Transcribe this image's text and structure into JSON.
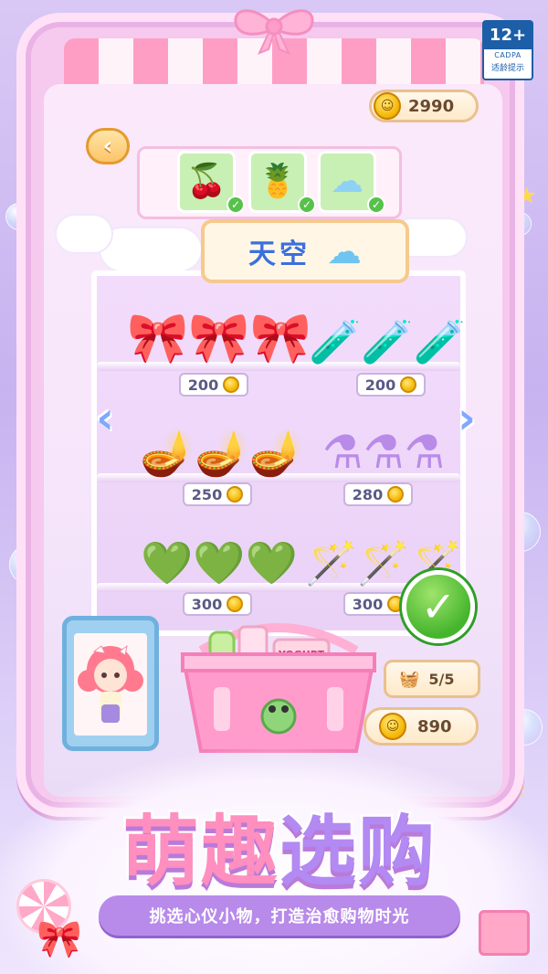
{
  "age_rating": {
    "number": "12+",
    "org": "CADPA",
    "label": "适龄提示"
  },
  "wallet": {
    "coins": "2990"
  },
  "nav": {
    "back_arrow": "‹"
  },
  "order": {
    "items": [
      {
        "icon": "cherry-icon",
        "glyph": "🍒",
        "done": "✓"
      },
      {
        "icon": "pineapple-icon",
        "glyph": "🍍",
        "done": "✓"
      },
      {
        "icon": "cloud-icon",
        "glyph": "☁",
        "done": "✓"
      }
    ]
  },
  "shelf": {
    "category": "天空",
    "prev_arrow": "‹",
    "next_arrow": "›",
    "rows": [
      {
        "items": [
          {
            "name": "bow-perfume-bottles",
            "glyph": "🎀",
            "price": "200"
          },
          {
            "name": "crown-potion-bottles",
            "glyph": "🧪",
            "price": "200"
          }
        ]
      },
      {
        "items": [
          {
            "name": "golden-lamps",
            "glyph": "🪔",
            "price": "250"
          },
          {
            "name": "heart-potion-flasks",
            "glyph": "⚗",
            "price": "280"
          }
        ]
      },
      {
        "items": [
          {
            "name": "heart-green-bottles",
            "glyph": "💚",
            "price": "300"
          },
          {
            "name": "magic-wands",
            "glyph": "🪄",
            "price": "300"
          }
        ]
      }
    ]
  },
  "basket": {
    "count": "5/5",
    "cart_icon": "basket-icon",
    "yogurt_label": "YOGURT"
  },
  "purchase": {
    "total": "890",
    "confirm": "✓"
  },
  "banner": {
    "title_chars": [
      "萌",
      "趣",
      "选",
      "购"
    ],
    "subtitle": "挑选心仪小物，打造治愈购物时光"
  },
  "colors": {
    "pink": "#ff8fbf",
    "purple": "#b389f2",
    "green": "#45b52c",
    "gold": "#f4b400",
    "blue": "#3b6fdc"
  }
}
